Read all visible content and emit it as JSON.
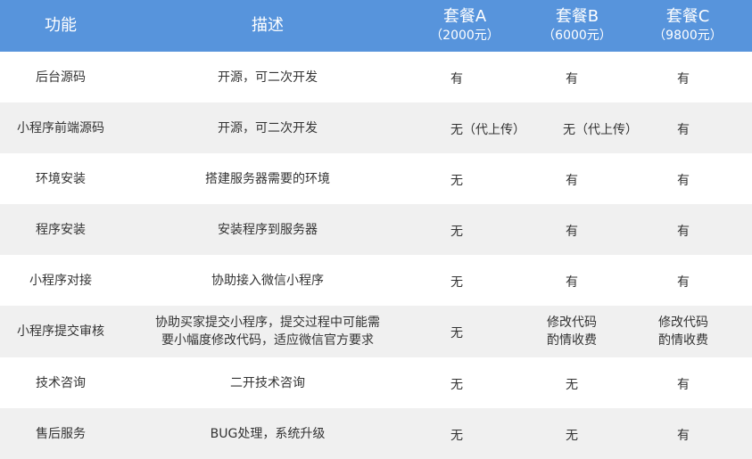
{
  "header": {
    "feature": "功能",
    "desc": "描述",
    "pkg_a": {
      "name": "套餐A",
      "price": "（2000元）"
    },
    "pkg_b": {
      "name": "套餐B",
      "price": "（6000元）"
    },
    "pkg_c": {
      "name": "套餐C",
      "price": "（9800元）"
    }
  },
  "rows": [
    {
      "feature": "后台源码",
      "desc": [
        "开源，可二次开发"
      ],
      "a": [
        "有"
      ],
      "b": [
        "有"
      ],
      "c": [
        "有"
      ]
    },
    {
      "feature": "小程序前端源码",
      "desc": [
        "开源，可二次开发"
      ],
      "a": [
        "无（代上传）"
      ],
      "b": [
        "无（代上传）"
      ],
      "c": [
        "有"
      ]
    },
    {
      "feature": "环境安装",
      "desc": [
        "搭建服务器需要的环境"
      ],
      "a": [
        "无"
      ],
      "b": [
        "有"
      ],
      "c": [
        "有"
      ]
    },
    {
      "feature": "程序安装",
      "desc": [
        "安装程序到服务器"
      ],
      "a": [
        "无"
      ],
      "b": [
        "有"
      ],
      "c": [
        "有"
      ]
    },
    {
      "feature": "小程序对接",
      "desc": [
        "协助接入微信小程序"
      ],
      "a": [
        "无"
      ],
      "b": [
        "有"
      ],
      "c": [
        "有"
      ]
    },
    {
      "feature": "小程序提交审核",
      "desc": [
        "协助买家提交小程序，提交过程中可能需",
        "要小幅度修改代码，适应微信官方要求"
      ],
      "a": [
        "无"
      ],
      "b": [
        "修改代码",
        "酌情收费"
      ],
      "c": [
        "修改代码",
        "酌情收费"
      ]
    },
    {
      "feature": "技术咨询",
      "desc": [
        "二开技术咨询"
      ],
      "a": [
        "无"
      ],
      "b": [
        "无"
      ],
      "c": [
        "有"
      ]
    },
    {
      "feature": "售后服务",
      "desc": [
        "BUG处理，系统升级"
      ],
      "a": [
        "无"
      ],
      "b": [
        "无"
      ],
      "c": [
        "有"
      ]
    }
  ]
}
